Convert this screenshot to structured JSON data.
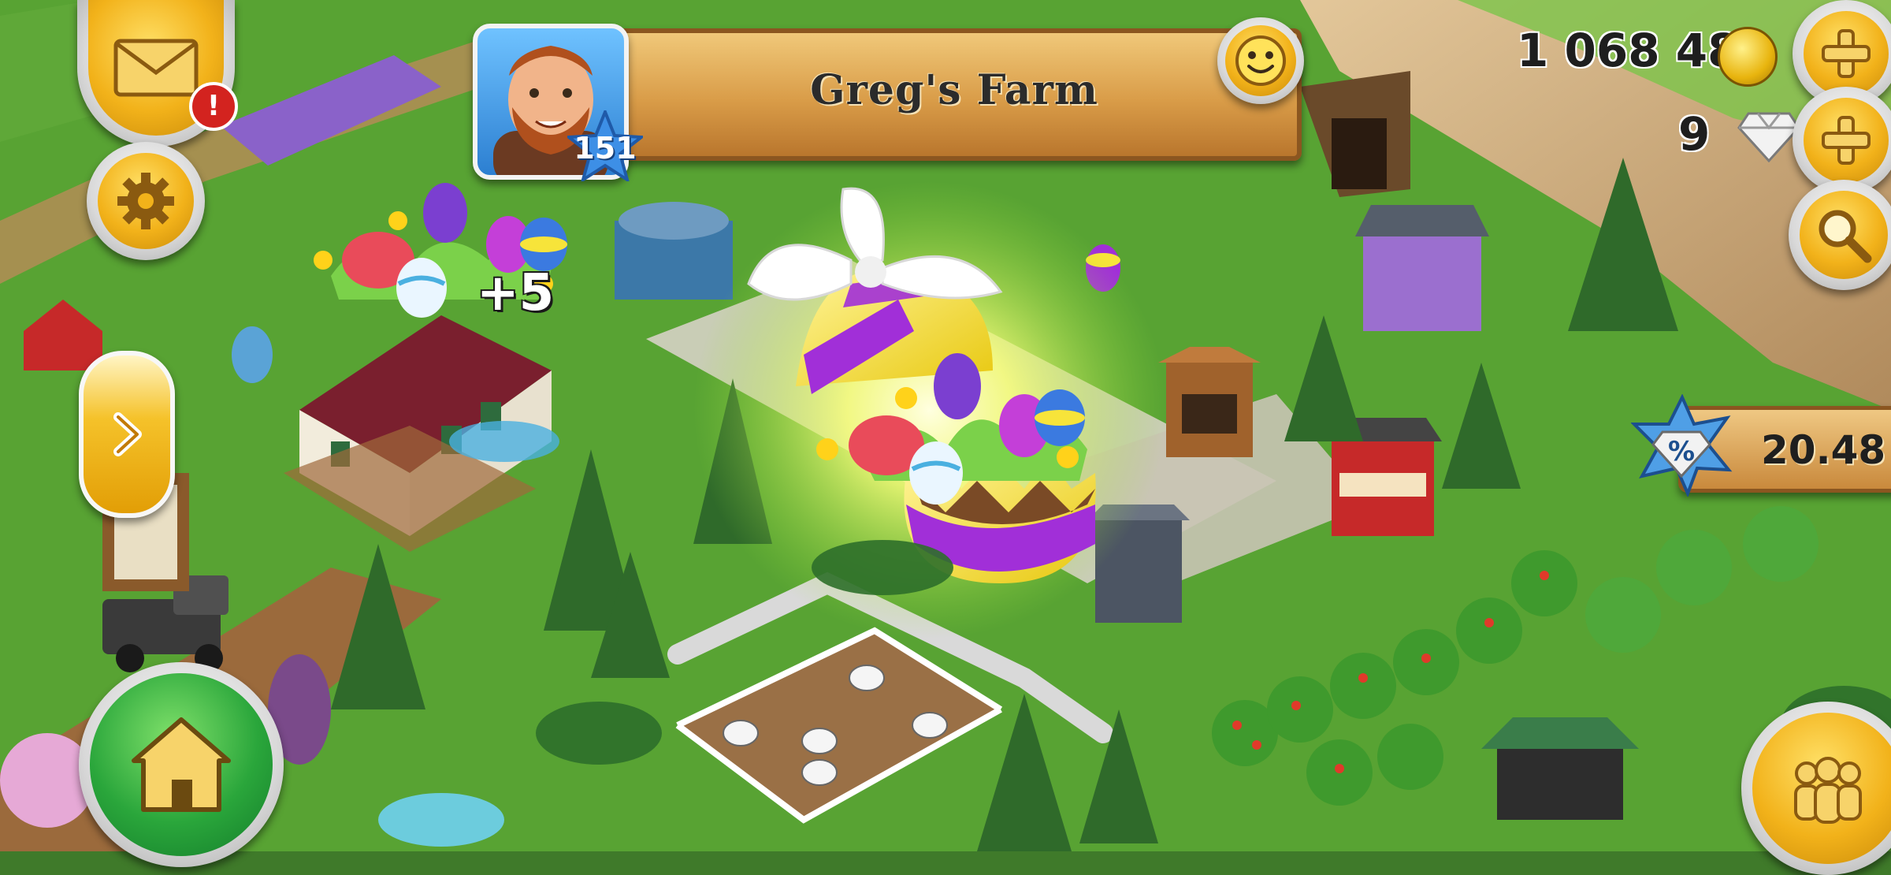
{
  "profile": {
    "farm_name": "Greg's Farm",
    "level": "151"
  },
  "currency": {
    "coins": "1 068 481",
    "diamonds": "9"
  },
  "event": {
    "reward_count": "+5"
  },
  "sale": {
    "timer": "20.48"
  },
  "colors": {
    "grass": "#4f9a2f",
    "button_gold": "#f2b21a",
    "banner_wood": "#d99c48",
    "home_green": "#2aa63b",
    "egg_purple": "#a12fd8",
    "egg_yellow": "#f7e43a"
  }
}
